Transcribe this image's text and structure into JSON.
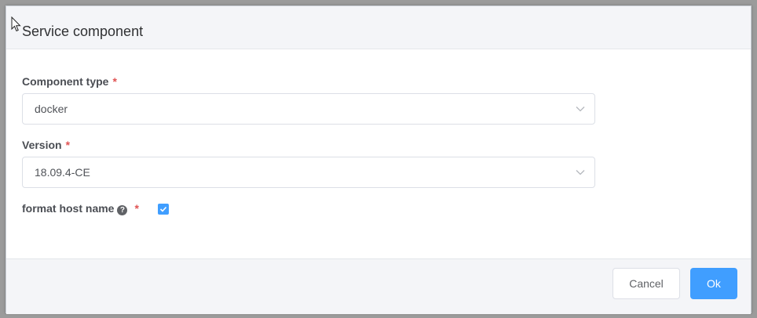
{
  "dialog": {
    "title": "Service component"
  },
  "form": {
    "component_type": {
      "label": "Component type",
      "required_mark": "*",
      "value": "docker"
    },
    "version": {
      "label": "Version",
      "required_mark": "*",
      "value": "18.09.4-CE"
    },
    "format_host_name": {
      "label": "format host name",
      "help_glyph": "?",
      "required_mark": "*",
      "checked": true
    }
  },
  "footer": {
    "cancel_label": "Cancel",
    "ok_label": "Ok"
  },
  "icons": {
    "cursor": "mouse-pointer-icon",
    "dropdown": "chevron-down-icon",
    "help": "question-circle-icon",
    "check": "checkmark-icon"
  },
  "colors": {
    "primary": "#409eff",
    "required": "#e05454",
    "header_bg": "#f4f5f8"
  }
}
